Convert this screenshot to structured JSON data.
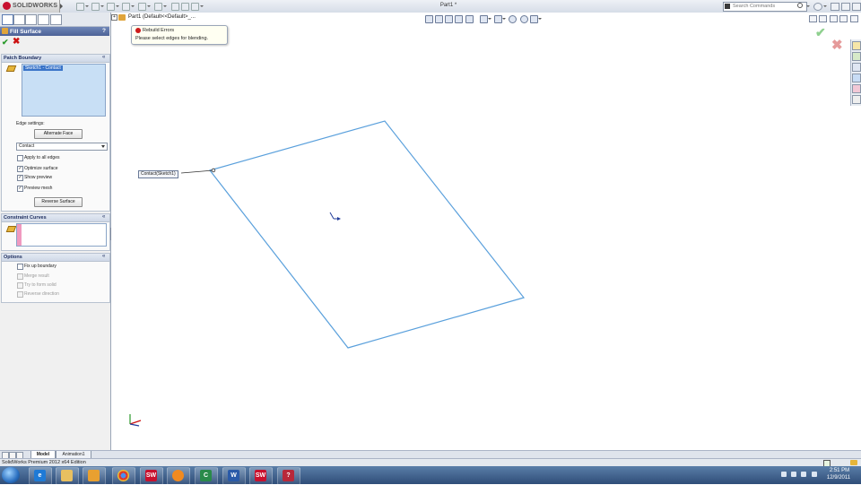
{
  "app": {
    "logo_text": "SOLIDWORKS",
    "document_title": "Part1 *",
    "search_placeholder": "Search Commands"
  },
  "tree": {
    "root_label": "Part1 (Default<<Default>_..."
  },
  "property_manager": {
    "title": "Fill Surface",
    "help": "?",
    "ok": "✔",
    "cancel": "✖",
    "patch_boundary": {
      "header": "Patch Boundary",
      "selected_item": "Sketch1 - Contact",
      "edge_settings_label": "Edge settings:",
      "alternate_face_button": "Alternate Face",
      "condition_value": "Contact",
      "apply_to_all_edges": {
        "label": "Apply to all edges",
        "checked": false
      },
      "optimize_surface": {
        "label": "Optimize surface",
        "checked": true
      },
      "show_preview": {
        "label": "Show preview",
        "checked": true
      },
      "preview_mesh": {
        "label": "Preview mesh",
        "checked": true
      },
      "reverse_surface_button": "Reverse Surface"
    },
    "constraint_curves": {
      "header": "Constraint Curves"
    },
    "options": {
      "header": "Options",
      "fix_up_boundary": {
        "label": "Fix up boundary",
        "enabled": true
      },
      "merge_result": {
        "label": "Merge result",
        "enabled": false
      },
      "try_to_form_solid": {
        "label": "Try to form solid",
        "enabled": false
      },
      "reverse_direction": {
        "label": "Reverse direction",
        "enabled": false
      }
    }
  },
  "tooltip": {
    "title": "Rebuild Errors",
    "message": "Please select edges for blending."
  },
  "callout": {
    "label": "Contact(Sketch1)"
  },
  "bottom_tabs": [
    {
      "label": "Model",
      "active": true
    },
    {
      "label": "Animation1",
      "active": false
    }
  ],
  "status_bar": {
    "text": "SolidWorks Premium 2012 x64 Edition"
  },
  "taskbar": {
    "time": "2:51 PM",
    "date": "12/9/2011"
  },
  "colors": {
    "sketch_line": "#5aa0dc",
    "title_bar": "#d6dde8",
    "pm_header": "#4d6297",
    "ok_green": "#2a9a2a",
    "cancel_red": "#cc1111",
    "taskbar": "#2f4d78"
  }
}
